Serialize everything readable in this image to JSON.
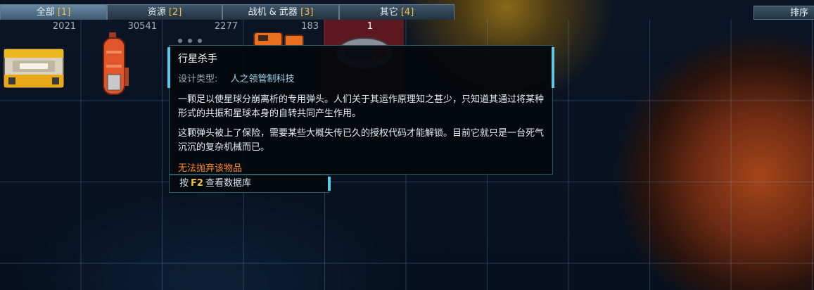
{
  "tabs": [
    {
      "label": "全部",
      "key": "[1]",
      "active": true
    },
    {
      "label": "资源",
      "key": "[2]",
      "active": false
    },
    {
      "label": "战机 & 武器",
      "key": "[3]",
      "active": false
    },
    {
      "label": "其它",
      "key": "[4]",
      "active": false
    }
  ],
  "sort_label": "排序",
  "items": [
    {
      "icon": "cargo-crate-icon",
      "count": "2021"
    },
    {
      "icon": "fuel-canister-icon",
      "count": "30541"
    },
    {
      "icon": "small-parts-icon",
      "count": "2277"
    },
    {
      "icon": "orange-device-icon",
      "count": "183"
    },
    {
      "icon": "warhead-icon",
      "count": "1",
      "selected": true
    }
  ],
  "tooltip": {
    "title": "行星杀手",
    "type_label": "设计类型:",
    "type_value": "人之领管制科技",
    "para1": "一颗足以使星球分崩离析的专用弹头。人们关于其运作原理知之甚少，只知道其通过将某种形式的共振和星球本身的自转共同产生作用。",
    "para2": "这颗弹头被上了保险，需要某些大概失传已久的授权代码才能解锁。目前它就只是一台死气沉沉的复杂机械而已。",
    "warning": "无法抛弃该物品",
    "footer_prefix": "按",
    "footer_key": "F2",
    "footer_suffix": "查看数据库"
  },
  "colors": {
    "accent": "#5ec8e6",
    "key_highlight": "#f0c040",
    "warning": "#ff8a20",
    "selected_slot": "#8a1e1e"
  }
}
